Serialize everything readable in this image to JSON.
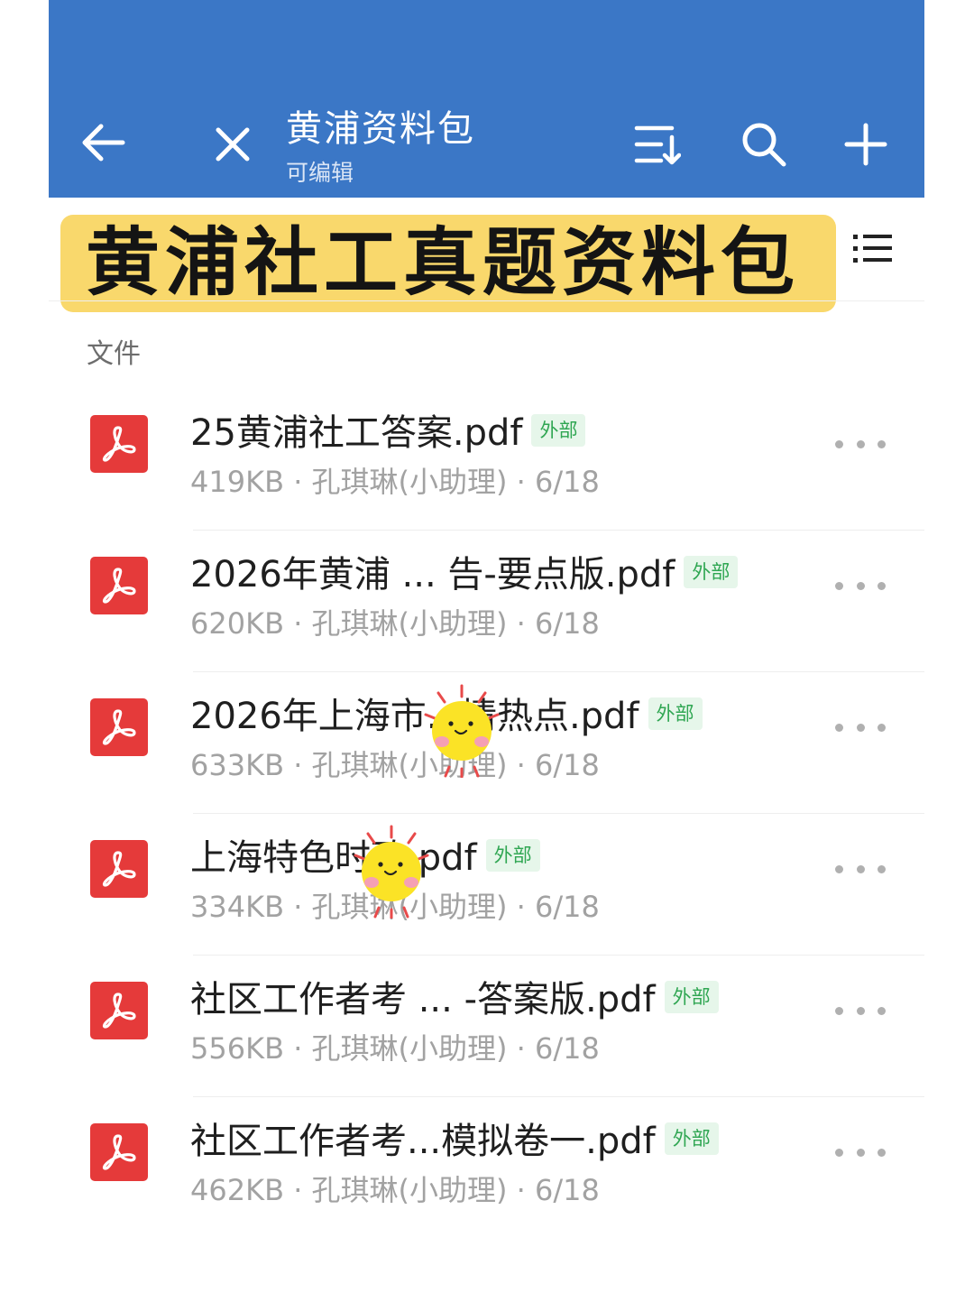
{
  "header": {
    "title": "黄浦资料包",
    "subtitle": "可编辑",
    "accent_color": "#3b77c6",
    "icons": [
      "back-arrow-icon",
      "close-icon",
      "sort-icon",
      "search-icon",
      "plus-icon"
    ]
  },
  "banner": {
    "text": "黄浦社工真题资料包",
    "color": "#f9d86c"
  },
  "section_label": "文件",
  "files": [
    {
      "name": "25黄浦社工答案.pdf",
      "tag": "外部",
      "meta": "419KB · 孔琪琳(小助理) · 6/18"
    },
    {
      "name": "2026年黄浦 ... 告-要点版.pdf",
      "tag": "外部",
      "meta": "620KB · 孔琪琳(小助理) · 6/18"
    },
    {
      "name": "2026年上海市...情热点.pdf",
      "tag": "外部",
      "meta": "633KB · 孔琪琳(小助理) · 6/18"
    },
    {
      "name": "上海特色时政.pdf",
      "tag": "外部",
      "meta": "334KB · 孔琪琳(小助理) · 6/18"
    },
    {
      "name": "社区工作者考 ... -答案版.pdf",
      "tag": "外部",
      "meta": "556KB · 孔琪琳(小助理) · 6/18"
    },
    {
      "name": "社区工作者考...模拟卷一.pdf",
      "tag": "外部",
      "meta": "462KB · 孔琪琳(小助理) · 6/18"
    }
  ]
}
